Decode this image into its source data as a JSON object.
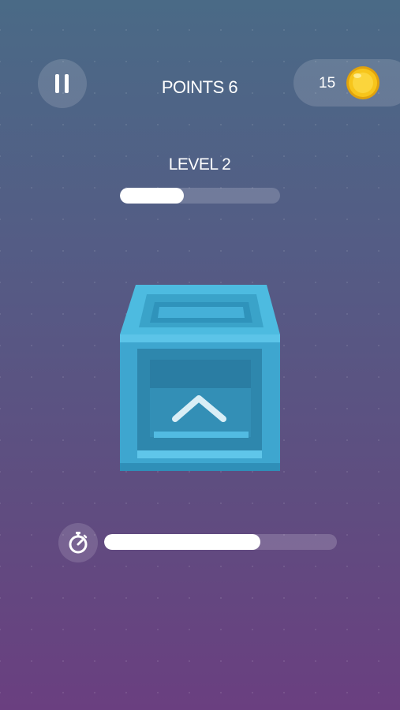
{
  "hud": {
    "pause_icon": "pause-icon",
    "points_text": "POINTS 6",
    "coins": "15",
    "coin_icon": "gold-coin-icon"
  },
  "level": {
    "label": "LEVEL 2",
    "progress": 0.4
  },
  "crate": {
    "icon": "chevron-up-icon",
    "color": "#3aa3c9"
  },
  "timer": {
    "icon": "stopwatch-icon",
    "remaining_fraction": 0.67
  },
  "colors": {
    "background_top": "#4a6a86",
    "background_bottom": "#6a3f80",
    "coin": "#f5c518"
  }
}
